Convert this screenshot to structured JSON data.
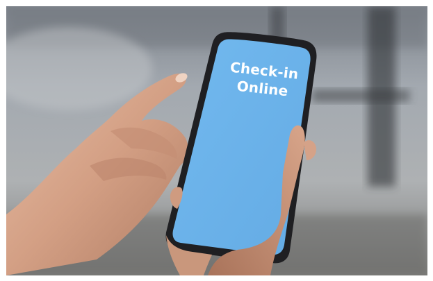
{
  "screen": {
    "line1": "Check-in",
    "line2": "Online"
  },
  "colors": {
    "screen": "#6cb4ec",
    "phone_body": "#1f1f22",
    "skin": "#d7a98f",
    "background": "#9aa0a6"
  }
}
